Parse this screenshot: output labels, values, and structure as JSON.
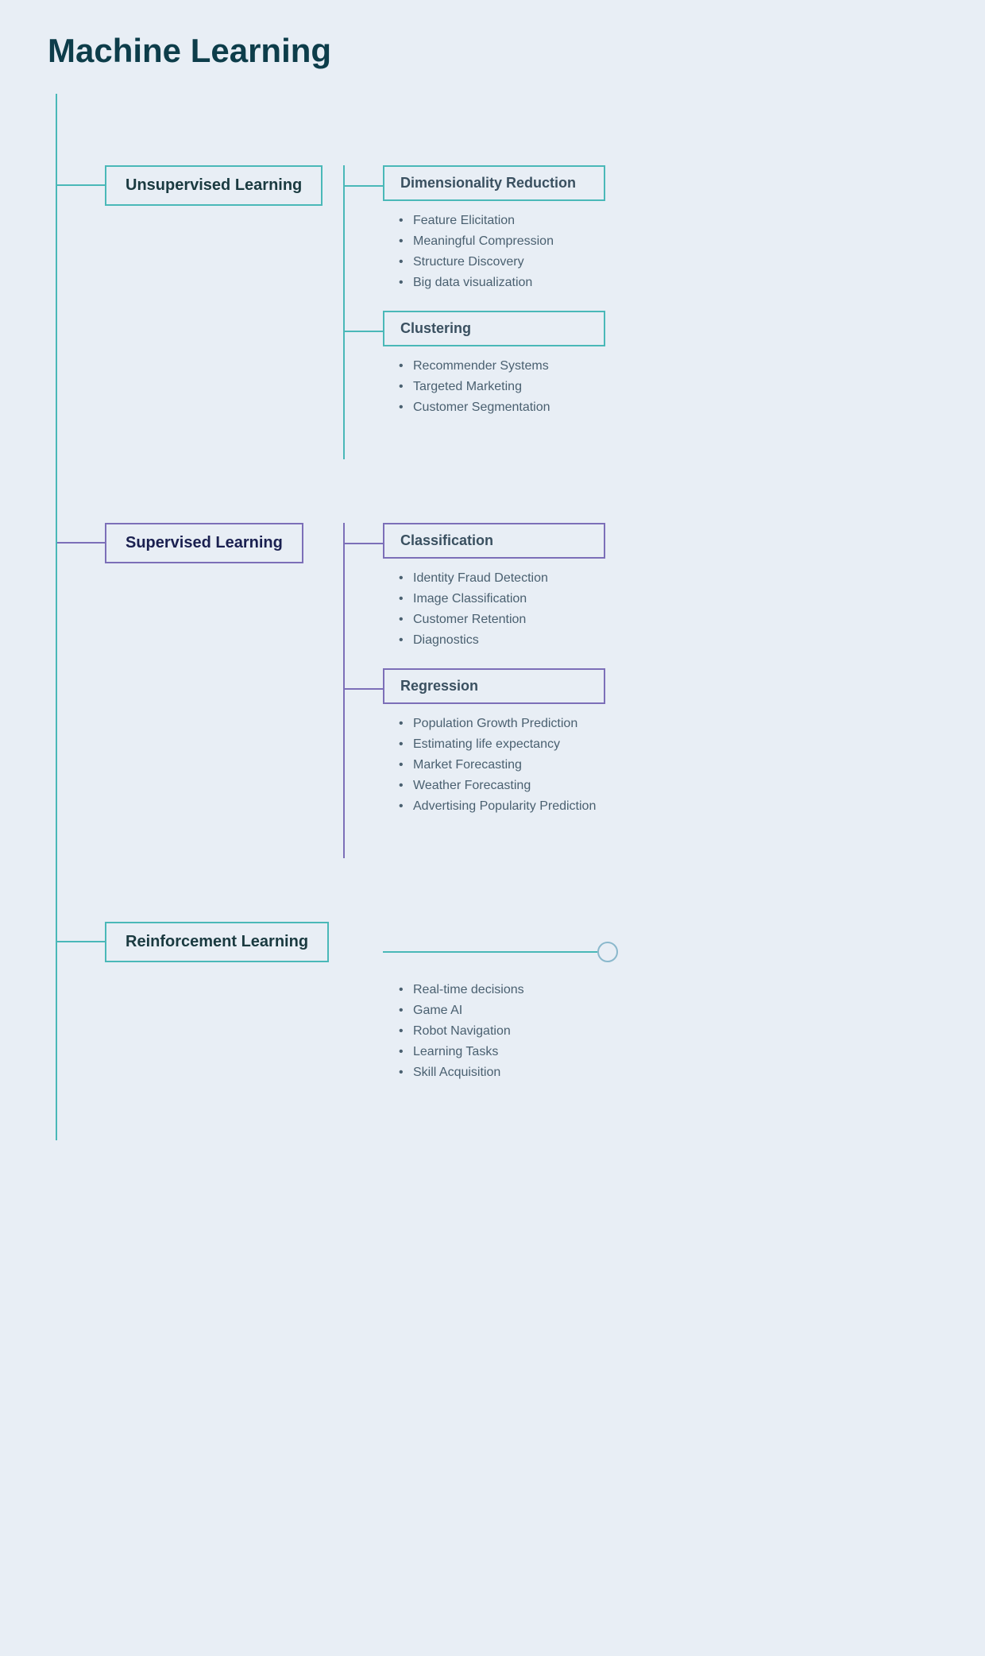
{
  "title": "Machine Learning",
  "sections": [
    {
      "id": "unsupervised",
      "label": "Unsupervised Learning",
      "color": "teal",
      "subsections": [
        {
          "id": "dimensionality-reduction",
          "label": "Dimensionality Reduction",
          "items": [
            "Feature Elicitation",
            "Meaningful Compression",
            "Structure Discovery",
            "Big data visualization"
          ]
        },
        {
          "id": "clustering",
          "label": "Clustering",
          "items": [
            "Recommender Systems",
            "Targeted Marketing",
            "Customer Segmentation"
          ]
        }
      ]
    },
    {
      "id": "supervised",
      "label": "Supervised Learning",
      "color": "purple",
      "subsections": [
        {
          "id": "classification",
          "label": "Classification",
          "items": [
            "Identity Fraud Detection",
            "Image Classification",
            "Customer Retention",
            "Diagnostics"
          ]
        },
        {
          "id": "regression",
          "label": "Regression",
          "items": [
            "Population Growth Prediction",
            "Estimating life expectancy",
            "Market Forecasting",
            "Weather Forecasting",
            "Advertising Popularity Prediction"
          ]
        }
      ]
    },
    {
      "id": "reinforcement",
      "label": "Reinforcement Learning",
      "color": "teal",
      "items": [
        "Real-time decisions",
        "Game AI",
        "Robot Navigation",
        "Learning Tasks",
        "Skill Acquisition"
      ]
    }
  ]
}
